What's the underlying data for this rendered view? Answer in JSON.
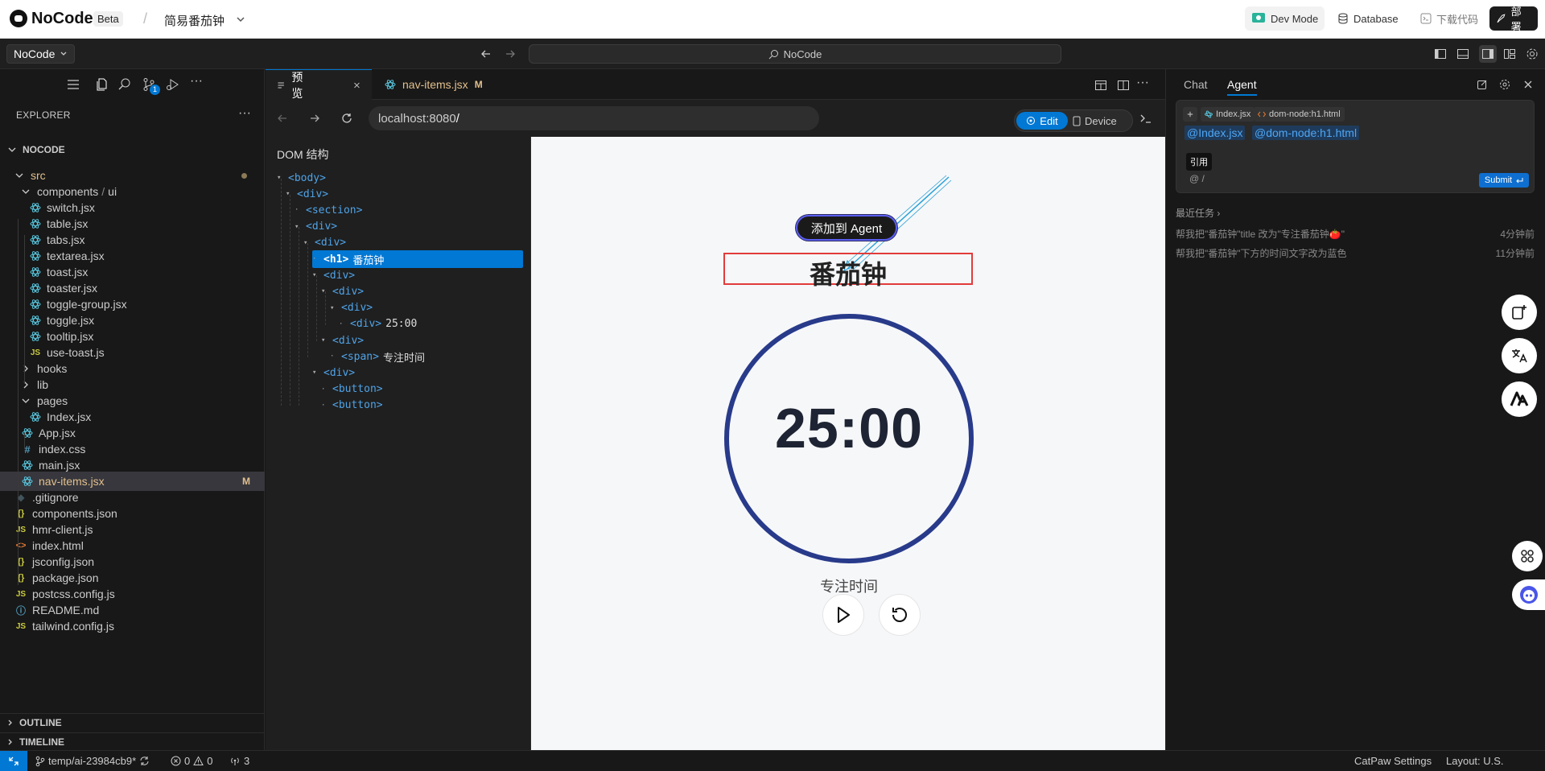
{
  "topbar": {
    "brand": "NoCode",
    "beta": "Beta",
    "project": "简易番茄钟",
    "dev_mode": "Dev Mode",
    "database": "Database",
    "download": "下载代码",
    "deploy": "部署"
  },
  "titlebar": {
    "workspace": "NoCode",
    "search": "NoCode"
  },
  "explorer": {
    "title": "EXPLORER",
    "root": "NOCODE",
    "scm_badge": "1",
    "outline": "OUTLINE",
    "timeline": "TIMELINE",
    "items": [
      {
        "label": "src",
        "kind": "folder-open",
        "mod": true
      },
      {
        "label": "components",
        "kind": "folder-open-path",
        "sub": "ui"
      },
      {
        "label": "switch.jsx",
        "kind": "react"
      },
      {
        "label": "table.jsx",
        "kind": "react"
      },
      {
        "label": "tabs.jsx",
        "kind": "react"
      },
      {
        "label": "textarea.jsx",
        "kind": "react"
      },
      {
        "label": "toast.jsx",
        "kind": "react"
      },
      {
        "label": "toaster.jsx",
        "kind": "react"
      },
      {
        "label": "toggle-group.jsx",
        "kind": "react"
      },
      {
        "label": "toggle.jsx",
        "kind": "react"
      },
      {
        "label": "tooltip.jsx",
        "kind": "react"
      },
      {
        "label": "use-toast.js",
        "kind": "js"
      },
      {
        "label": "hooks",
        "kind": "folder"
      },
      {
        "label": "lib",
        "kind": "folder"
      },
      {
        "label": "pages",
        "kind": "folder-open"
      },
      {
        "label": "Index.jsx",
        "kind": "react"
      },
      {
        "label": "App.jsx",
        "kind": "react"
      },
      {
        "label": "index.css",
        "kind": "css"
      },
      {
        "label": "main.jsx",
        "kind": "react"
      },
      {
        "label": "nav-items.jsx",
        "kind": "react",
        "selected": true,
        "badge": "M"
      },
      {
        "label": ".gitignore",
        "kind": "git"
      },
      {
        "label": "components.json",
        "kind": "json"
      },
      {
        "label": "hmr-client.js",
        "kind": "js"
      },
      {
        "label": "index.html",
        "kind": "html"
      },
      {
        "label": "jsconfig.json",
        "kind": "json"
      },
      {
        "label": "package.json",
        "kind": "json"
      },
      {
        "label": "postcss.config.js",
        "kind": "js"
      },
      {
        "label": "README.md",
        "kind": "info"
      },
      {
        "label": "tailwind.config.js",
        "kind": "js"
      }
    ]
  },
  "editor": {
    "tab_preview": "预览",
    "tab_file": "nav-items.jsx",
    "tab_file_badge": "M",
    "url_host": "localhost:8080",
    "url_path": "/",
    "edit": "Edit",
    "device": "Device"
  },
  "dom_panel": {
    "title": "DOM 结构",
    "nodes": [
      {
        "tag": "<body>",
        "text": "",
        "toggle": "open"
      },
      {
        "tag": "<div>",
        "text": "",
        "toggle": "open"
      },
      {
        "tag": "<section>",
        "text": "",
        "toggle": "leaf"
      },
      {
        "tag": "<div>",
        "text": "",
        "toggle": "open"
      },
      {
        "tag": "<div>",
        "text": "",
        "toggle": "open"
      },
      {
        "tag": "<h1>",
        "text": "番茄钟",
        "toggle": "leaf",
        "selected": true
      },
      {
        "tag": "<div>",
        "text": "",
        "toggle": "open"
      },
      {
        "tag": "<div>",
        "text": "",
        "toggle": "open"
      },
      {
        "tag": "<div>",
        "text": "",
        "toggle": "open"
      },
      {
        "tag": "<div>",
        "text": "25:00",
        "toggle": "leaf"
      },
      {
        "tag": "<div>",
        "text": "",
        "toggle": "open"
      },
      {
        "tag": "<span>",
        "text": "专注时间",
        "toggle": "leaf"
      },
      {
        "tag": "<div>",
        "text": "",
        "toggle": "open"
      },
      {
        "tag": "<button>",
        "text": "",
        "toggle": "leaf"
      },
      {
        "tag": "<button>",
        "text": "",
        "toggle": "leaf"
      }
    ]
  },
  "preview": {
    "add_to_agent": "添加到 Agent",
    "title": "番茄钟",
    "timer": "25:00",
    "label": "专注时间",
    "play_icon": "play-icon",
    "reset_icon": "reset-icon"
  },
  "agent_panel": {
    "tab_chat": "Chat",
    "tab_agent": "Agent",
    "ctx_file": "Index.jsx",
    "ctx_node": "dom-node:h1.html",
    "mention_file": "@Index.jsx",
    "mention_node": "@dom-node:h1.html",
    "quote": "引用",
    "input_hint": "@  /",
    "submit": "Submit",
    "recent_label": "最近任务",
    "tasks": [
      {
        "text": "帮我把\"番茄钟\"title 改为\"专注番茄钟🍅\"",
        "time": "4分钟前"
      },
      {
        "text": "帮我把\"番茄钟\"下方的时间文字改为蓝色",
        "time": "11分钟前"
      }
    ]
  },
  "statusbar": {
    "branch": "temp/ai-23984cb9*",
    "errors": "0",
    "warnings": "0",
    "ports": "3",
    "catpaw": "CatPaw Settings",
    "layout": "Layout: U.S."
  },
  "colors": {
    "accent": "#0078d4",
    "modified": "#e2c08d",
    "timer_ring": "#283a8a",
    "highlight_box": "#e23b3b"
  }
}
